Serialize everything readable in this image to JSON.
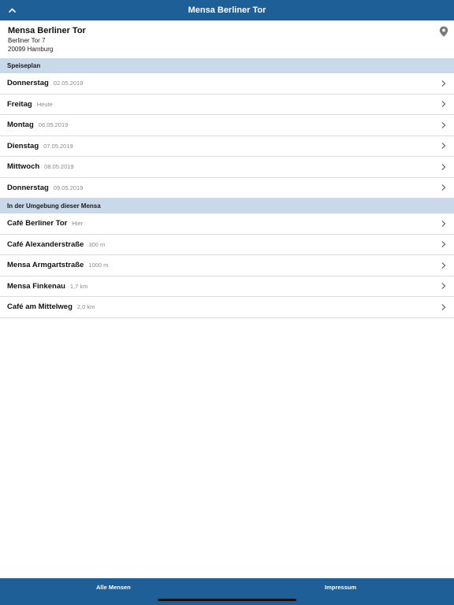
{
  "navbar": {
    "title": "Mensa Berliner Tor"
  },
  "header": {
    "name": "Mensa Berliner Tor",
    "street": "Berliner Tor 7",
    "city": "20099 Hamburg"
  },
  "sections": {
    "menu": "Speiseplan",
    "nearby": "In der Umgebung dieser Mensa"
  },
  "menu_days": [
    {
      "day": "Donnerstag",
      "date": "02.05.2019"
    },
    {
      "day": "Freitag",
      "date": "Heute"
    },
    {
      "day": "Montag",
      "date": "06.05.2019"
    },
    {
      "day": "Dienstag",
      "date": "07.05.2019"
    },
    {
      "day": "Mittwoch",
      "date": "08.05.2019"
    },
    {
      "day": "Donnerstag",
      "date": "09.05.2019"
    }
  ],
  "nearby": [
    {
      "name": "Café Berliner Tor",
      "distance": "Hier"
    },
    {
      "name": "Café Alexanderstraße",
      "distance": "300 m"
    },
    {
      "name": "Mensa Armgartstraße",
      "distance": "1000 m"
    },
    {
      "name": "Mensa Finkenau",
      "distance": "1,7 km"
    },
    {
      "name": "Café am Mittelweg",
      "distance": "2,0 km"
    }
  ],
  "tabbar": {
    "left": "Alle Mensen",
    "right": "Impressum"
  },
  "colors": {
    "navbar": "#1f5f97",
    "section": "#c9d9ea",
    "divider": "#dcdcdc"
  },
  "icons": {
    "back": "chevron-up-icon",
    "location": "map-pin-icon",
    "row": "chevron-right-icon"
  }
}
